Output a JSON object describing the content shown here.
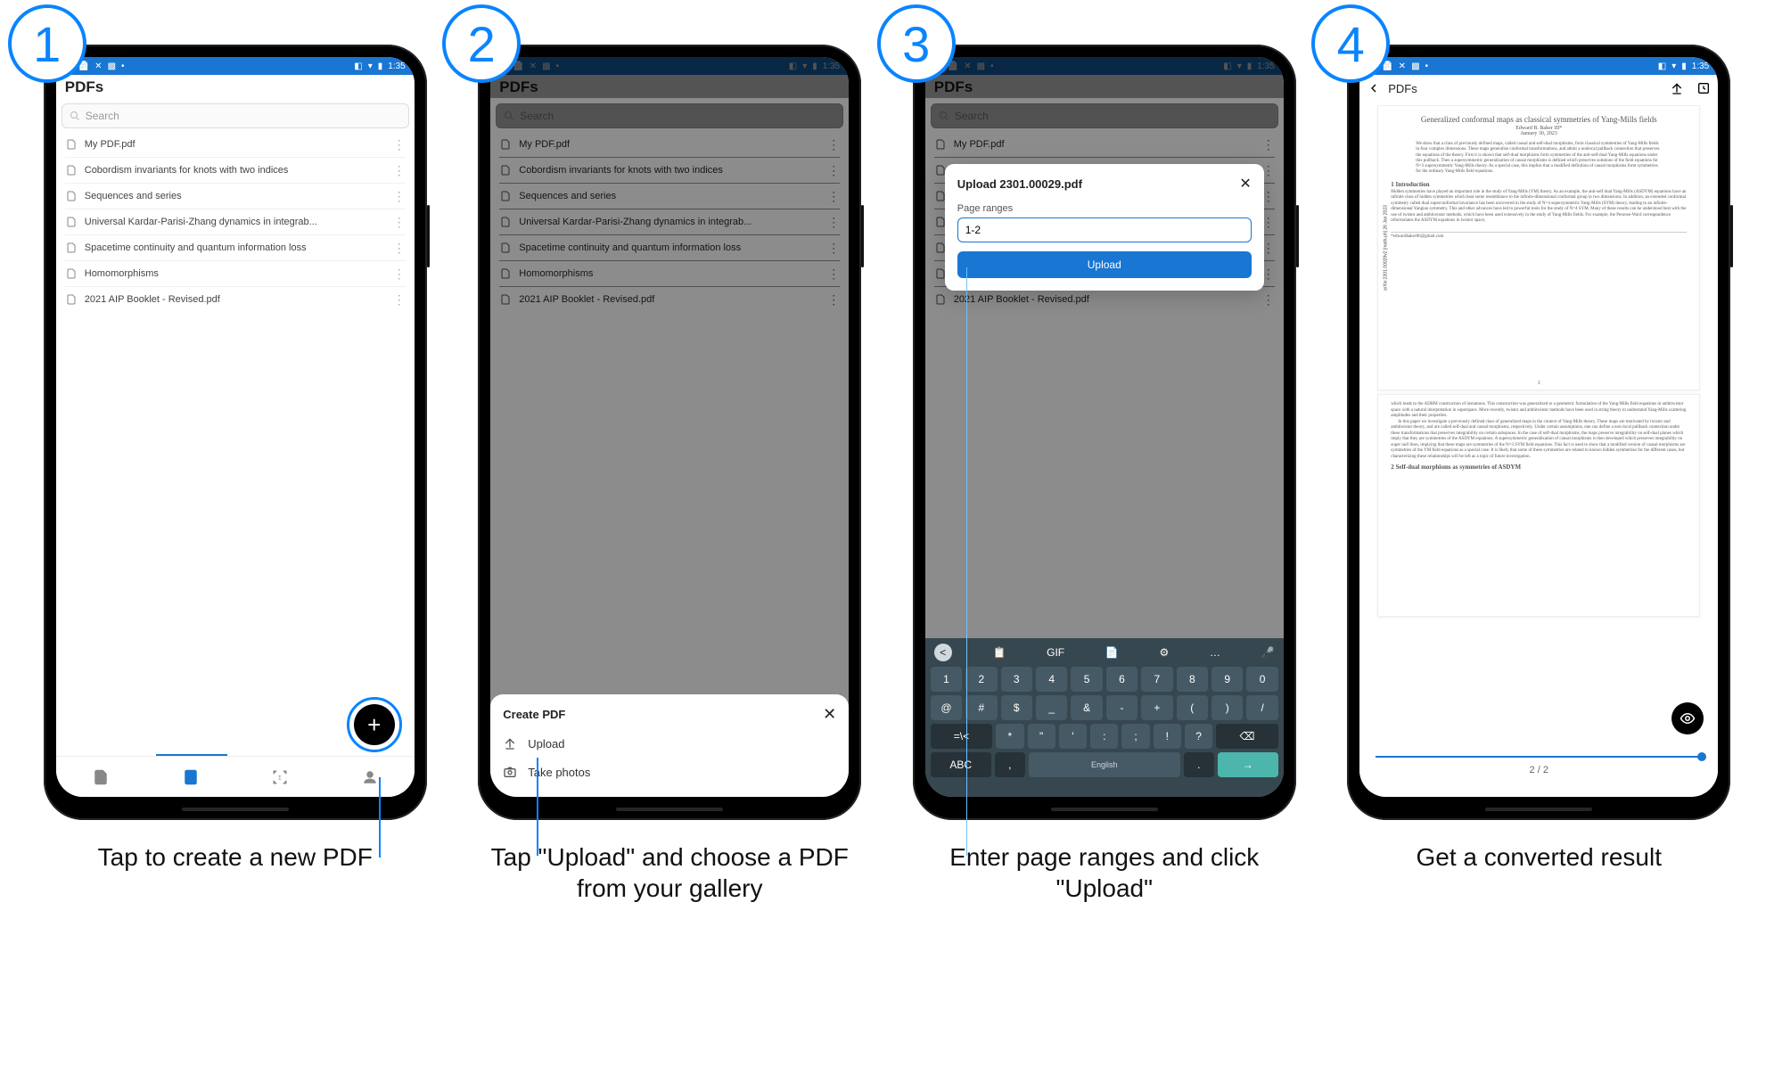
{
  "status_time": "1:35",
  "app_title": "PDFs",
  "search_placeholder": "Search",
  "pdf_list": [
    "My PDF.pdf",
    "Cobordism invariants for knots with two indices",
    "Sequences and series",
    "Universal Kardar-Parisi-Zhang dynamics in integrab...",
    "Spacetime continuity and quantum information loss",
    "Homomorphisms",
    "2021 AIP Booklet - Revised.pdf"
  ],
  "fab_glyph": "+",
  "steps": {
    "1": {
      "caption": "Tap to create a new PDF"
    },
    "2": {
      "caption": "Tap \"Upload\" and choose a PDF from your gallery"
    },
    "3": {
      "caption": "Enter page ranges and click \"Upload\""
    },
    "4": {
      "caption": "Get a converted result"
    }
  },
  "badges": [
    "1",
    "2",
    "3",
    "4"
  ],
  "create_sheet": {
    "title": "Create PDF",
    "items": [
      "Upload",
      "Take photos"
    ]
  },
  "upload_dialog": {
    "title_prefix": "Upload ",
    "filename": "2301.00029.pdf",
    "label": "Page ranges",
    "value": "1-2",
    "button": "Upload"
  },
  "keyboard": {
    "toolbar": [
      "<",
      "📋",
      "GIF",
      "📄",
      "⚙",
      "…",
      "🎤"
    ],
    "row1": [
      "1",
      "2",
      "3",
      "4",
      "5",
      "6",
      "7",
      "8",
      "9",
      "0"
    ],
    "row2": [
      "@",
      "#",
      "$",
      "_",
      "&",
      "-",
      "+",
      "(",
      ")",
      "/"
    ],
    "row3_left": "=\\<",
    "row3_keys": [
      "*",
      "\"",
      "'",
      ":",
      ";",
      "!",
      "?"
    ],
    "row3_bksp": "⌫",
    "row4_abc": "ABC",
    "row4_comma": ",",
    "row4_space": "English",
    "row4_period": ".",
    "row4_go": "→"
  },
  "viewer": {
    "back_label": "PDFs",
    "paper_title": "Generalized conformal maps as classical symmetries of Yang-Mills fields",
    "author": "Edward B. Baker III*",
    "date": "January 30, 2023",
    "arxiv_side": "arXiv:2301.00029v2  [math-ph]  26 Jan 2023",
    "abstract": "We show that a class of previously defined maps, called causal and self-dual morphisms, form classical symmetries of Yang-Mills fields in four complex dimensions. These maps generalize conformal transformations, and admit a nonlocal pullback connection that preserves the equations of the theory. First it is shown that self-dual morphisms form symmetries of the anti-self-dual Yang-Mills equations under this pullback. Then a supersymmetric generalization of causal morphisms is defined which preserves solutions of the field equations for N=3 supersymmetric Yang-Mills theory. As a special case, this implies that a modified definition of causal morphisms form symmetries for the ordinary Yang-Mills field equations.",
    "sec1_title": "1   Introduction",
    "sec1_body": "Hidden symmetries have played an important role in the study of Yang-Mills (YM) theory. As an example, the anti-self dual Yang-Mills (ASDYM) equations have an infinite class of hidden symmetries which bear some resemblance to the infinite-dimensional conformal group in two dimensions. In addition, an extended conformal symmetry called dual superconformal invariance has been uncovered in the study of N=4 supersymmetric Yang-Mills (SYM) theory, leading to an infinite-dimensional Yangian symmetry. This and other advances have led to powerful tools for the study of N=4 SYM. Many of these results can be understood best with the use of twistor and ambitwistor methods, which have been used extensively in the study of Yang-Mills fields. For example, the Penrose-Ward correspondence reformulates the ASDYM equations in twistor space,",
    "footer_email": "*edwardbaker86@gmail.com",
    "page1_num": "1",
    "sec_p2_lead": "which leads to the ADHM construction of instantons. This construction was generalized to a geometric formulation of the Yang-Mills field equations in ambitwistor space with a natural interpretation in superspace. More recently, twistor and ambitwistor methods have been used in string theory to understand Yang-Mills scattering amplitudes and their properties.",
    "sec_p2_body": "In this paper we investigate a previously defined class of generalized maps in the context of Yang-Mills theory. These maps are motivated by twistor and ambitwistor theory, and are called self-dual and causal morphisms, respectively. Under certain assumptions, one can define a non-local pullback connection under these transformations that preserves integrability on certain subspaces. In the case of self-dual morphisms, the maps preserve integrability on self-dual planes which imply that they are symmetries of the ASDYM equations. A supersymmetric generalization of causal morphisms is then developed which preserves integrability on super null lines, implying that these maps are symmetries of the N=3 SYM field equations. This fact is used to show that a modified version of causal morphisms are symmetries of the YM field equations as a special case. It is likely that some of these symmetries are related to known hidden symmetries for the different cases, but characterizing these relationships will be left as a topic of future investigation.",
    "sec2_title": "2   Self-dual morphisms as symmetries of ASDYM",
    "page_indicator": "2 / 2"
  }
}
